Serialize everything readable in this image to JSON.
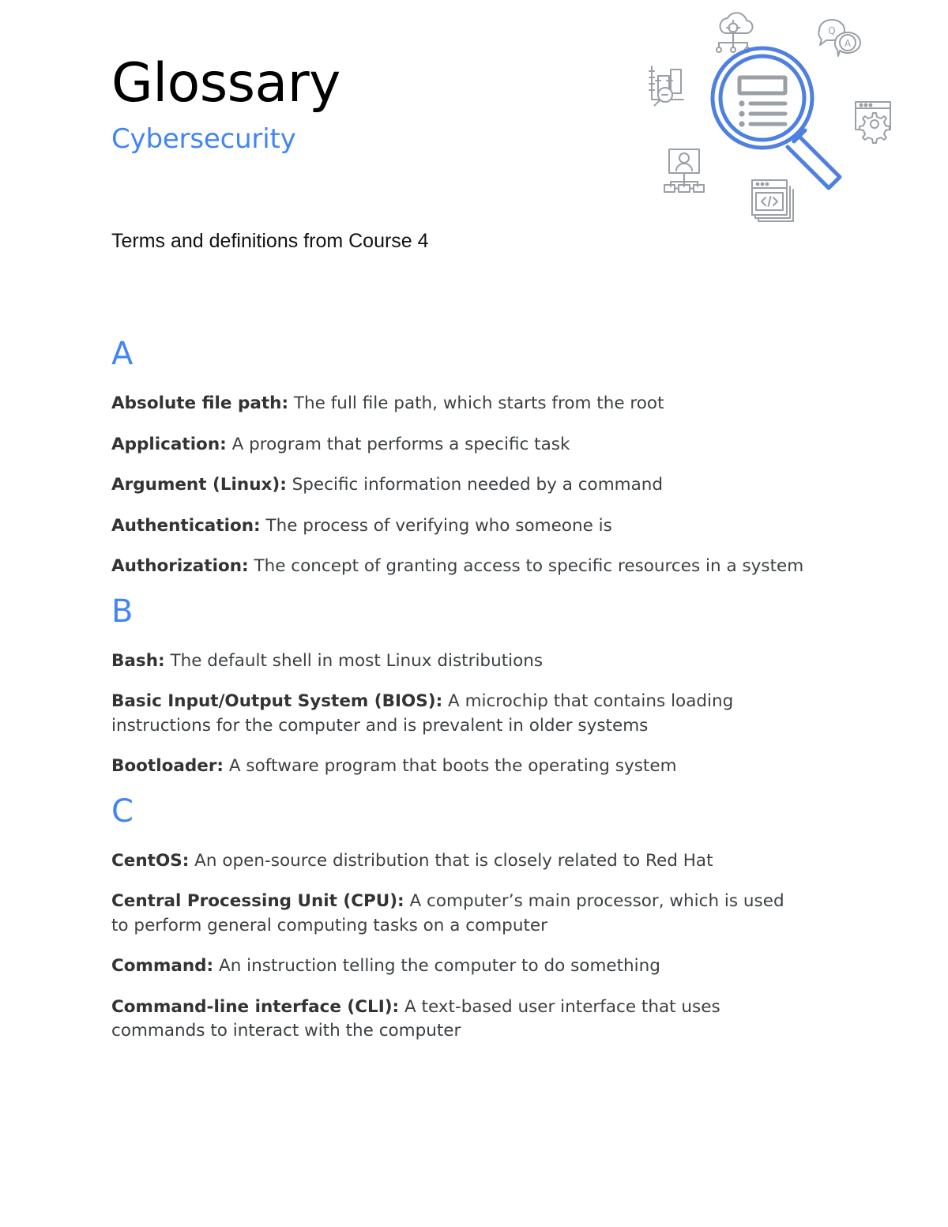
{
  "document": {
    "title": "Glossary",
    "subtitle": "Cybersecurity",
    "tagline": "Terms and definitions from Course 4",
    "accent_color": "#4285f4",
    "text_color": "#3c4043",
    "background_color": "#ffffff"
  },
  "illustration": {
    "name": "magnifying-glass-search-illustration",
    "primary_color": "#4e80e0",
    "secondary_color": "#9aa0a6",
    "icons": [
      "cloud-network-icon",
      "question-answer-bubbles-icon",
      "bar-chart-analysis-icon",
      "browser-settings-gear-icon",
      "user-org-chart-icon",
      "code-window-icon",
      "magnifier-list-icon"
    ]
  },
  "sections": [
    {
      "letter": "A",
      "entries": [
        {
          "term": "Absolute file path:",
          "definition": "The full file path, which starts from the root"
        },
        {
          "term": "Application:",
          "definition": "A program that performs a specific task"
        },
        {
          "term": "Argument (Linux):",
          "definition": "Specific information needed by a command"
        },
        {
          "term": "Authentication:",
          "definition": "The process of verifying who someone is"
        },
        {
          "term": "Authorization:",
          "definition": "The concept of granting access to specific resources in a system"
        }
      ]
    },
    {
      "letter": "B",
      "entries": [
        {
          "term": "Bash:",
          "definition": "The default shell in most Linux distributions"
        },
        {
          "term": "Basic Input/Output System (BIOS):",
          "definition": "A microchip that contains loading instructions for the computer and is prevalent in older systems"
        },
        {
          "term": "Bootloader:",
          "definition": "A software program that boots the operating system"
        }
      ]
    },
    {
      "letter": "C",
      "entries": [
        {
          "term": "CentOS:",
          "definition": "An open-source distribution that is closely related to Red Hat"
        },
        {
          "term": "Central Processing Unit (CPU):",
          "definition": "A computer’s main processor, which is used to perform general computing tasks on a computer"
        },
        {
          "term": "Command:",
          "definition": "An instruction telling the computer to do something"
        },
        {
          "term": "Command-line interface (CLI):",
          "definition": "A text-based user interface that uses commands to interact with the computer"
        }
      ]
    }
  ]
}
